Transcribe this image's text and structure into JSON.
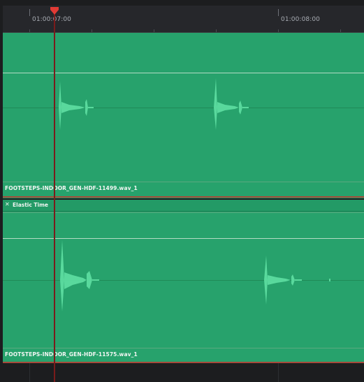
{
  "ruler": {
    "timecodes": [
      "01:00:07:00",
      "01:00:08:00"
    ]
  },
  "tracks": [
    {
      "clip_name": "FOOTSTEPS-INDOOR_GEN-HDF-11499.wav_1"
    },
    {
      "elastic_label": "Elastic Time",
      "clip_name": "FOOTSTEPS-INDOOR_GEN-HDF-11575.wav_1"
    }
  ],
  "icons": {
    "close": "close-icon",
    "playhead": "playhead-marker-icon"
  },
  "colors": {
    "clip_background": "#27a26c",
    "playhead": "#e23b35",
    "waveform": "#5fe0a3"
  }
}
